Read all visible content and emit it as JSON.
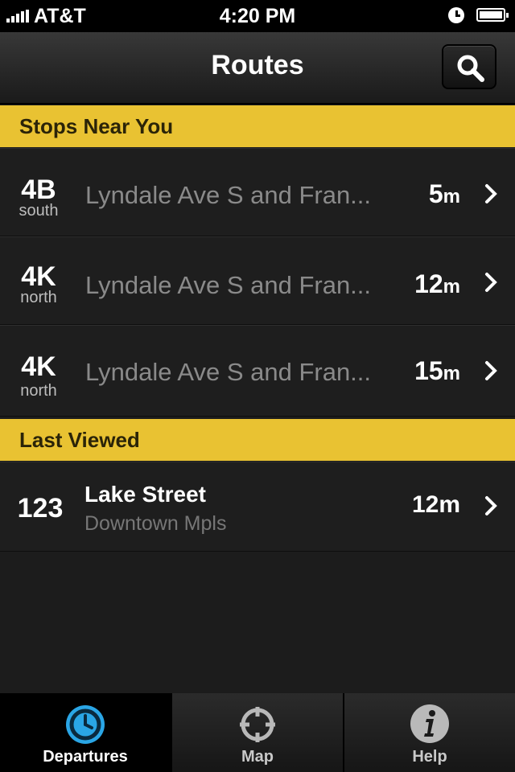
{
  "status_bar": {
    "carrier": "AT&T",
    "time": "4:20 PM"
  },
  "nav": {
    "title": "Routes"
  },
  "sections": {
    "near": "Stops Near You",
    "last": "Last Viewed"
  },
  "near_stops": [
    {
      "route": "4B",
      "direction": "south",
      "stop": "Lyndale Ave S and Fran...",
      "time_num": "5",
      "time_unit": "m"
    },
    {
      "route": "4K",
      "direction": "north",
      "stop": "Lyndale Ave S and Fran...",
      "time_num": "12",
      "time_unit": "m"
    },
    {
      "route": "4K",
      "direction": "north",
      "stop": "Lyndale Ave S and Fran...",
      "time_num": "15",
      "time_unit": "m"
    }
  ],
  "last_viewed": [
    {
      "route": "123",
      "title": "Lake Street",
      "subtitle": "Downtown Mpls",
      "time": "12m"
    }
  ],
  "tabs": [
    {
      "label": "Departures",
      "icon": "clock-icon",
      "active": true
    },
    {
      "label": "Map",
      "icon": "crosshair-icon",
      "active": false
    },
    {
      "label": "Help",
      "icon": "info-icon",
      "active": false
    }
  ],
  "colors": {
    "section_header": "#e9c232",
    "accent_blue": "#2aa6e6"
  }
}
